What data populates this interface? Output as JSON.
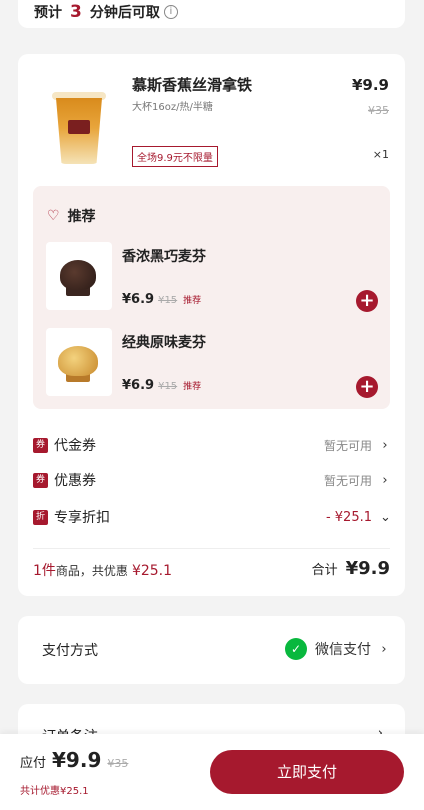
{
  "pickup": {
    "prefix": "预计",
    "minutes": "3",
    "suffix": "分钟后可取",
    "info_icon": "info-icon"
  },
  "order": {
    "product": {
      "name": "慕斯香蕉丝滑拿铁",
      "spec": "大杯16oz/热/半糖",
      "price": "¥9.9",
      "original_price": "¥35",
      "promo_tag": "全场9.9元不限量",
      "quantity": "×1"
    },
    "recommend": {
      "title": "推荐",
      "icon": "heart-icon",
      "items": [
        {
          "name": "香浓黑巧麦芬",
          "price": "¥6.9",
          "original_price": "¥15",
          "label": "推荐"
        },
        {
          "name": "经典原味麦芬",
          "price": "¥6.9",
          "original_price": "¥15",
          "label": "推荐"
        }
      ]
    },
    "fees": [
      {
        "icon_text": "券",
        "label": "代金券",
        "value": "暂无可用"
      },
      {
        "icon_text": "券",
        "label": "优惠券",
        "value": "暂无可用"
      },
      {
        "icon_text": "折",
        "label": "专享折扣",
        "value": "- ¥25.1"
      }
    ],
    "summary": {
      "count": "1件",
      "text": "商品，共优惠",
      "discount": "¥25.1",
      "total_label": "合计",
      "total": "¥9.9"
    }
  },
  "payment": {
    "label": "支付方式",
    "method": "微信支付",
    "icon": "wechat-icon"
  },
  "remark": {
    "label": "订单备注"
  },
  "bottom_bar": {
    "due_label": "应付",
    "due_amount": "¥9.9",
    "original": "¥35",
    "discount_text": "共计优惠¥25.1",
    "pay_button": "立即支付"
  },
  "colors": {
    "accent": "#a6192e",
    "wechat": "#09b83e",
    "background": "#f3f3f3"
  }
}
